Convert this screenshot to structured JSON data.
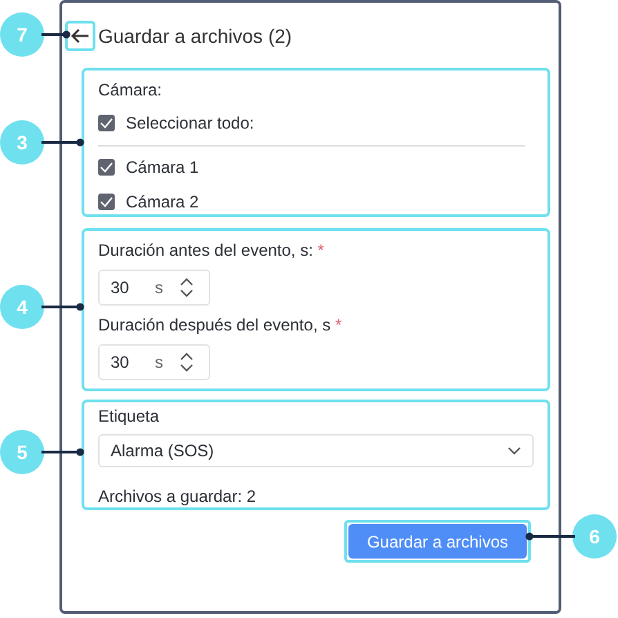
{
  "header": {
    "back_icon_highlighted": true,
    "title": "Guardar a archivos (2)"
  },
  "camera_section": {
    "label": "Cámara:",
    "select_all": {
      "label": "Seleccionar todo:",
      "checked": true
    },
    "cameras": [
      {
        "label": "Cámara 1",
        "checked": true
      },
      {
        "label": "Cámara 2",
        "checked": true
      }
    ]
  },
  "duration_section": {
    "fields": [
      {
        "label": "Duración antes del evento, s:",
        "required_mark": "*",
        "value": "30",
        "unit": "s"
      },
      {
        "label": "Duración después del evento, s",
        "required_mark": "*",
        "value": "30",
        "unit": "s"
      }
    ]
  },
  "tag_section": {
    "label": "Etiqueta",
    "select_value": "Alarma (SOS)",
    "files_note": "Archivos a guardar: 2"
  },
  "save_button": "Guardar a archivos",
  "callouts": [
    {
      "number": "7"
    },
    {
      "number": "3"
    },
    {
      "number": "4"
    },
    {
      "number": "5"
    },
    {
      "number": "6"
    }
  ]
}
